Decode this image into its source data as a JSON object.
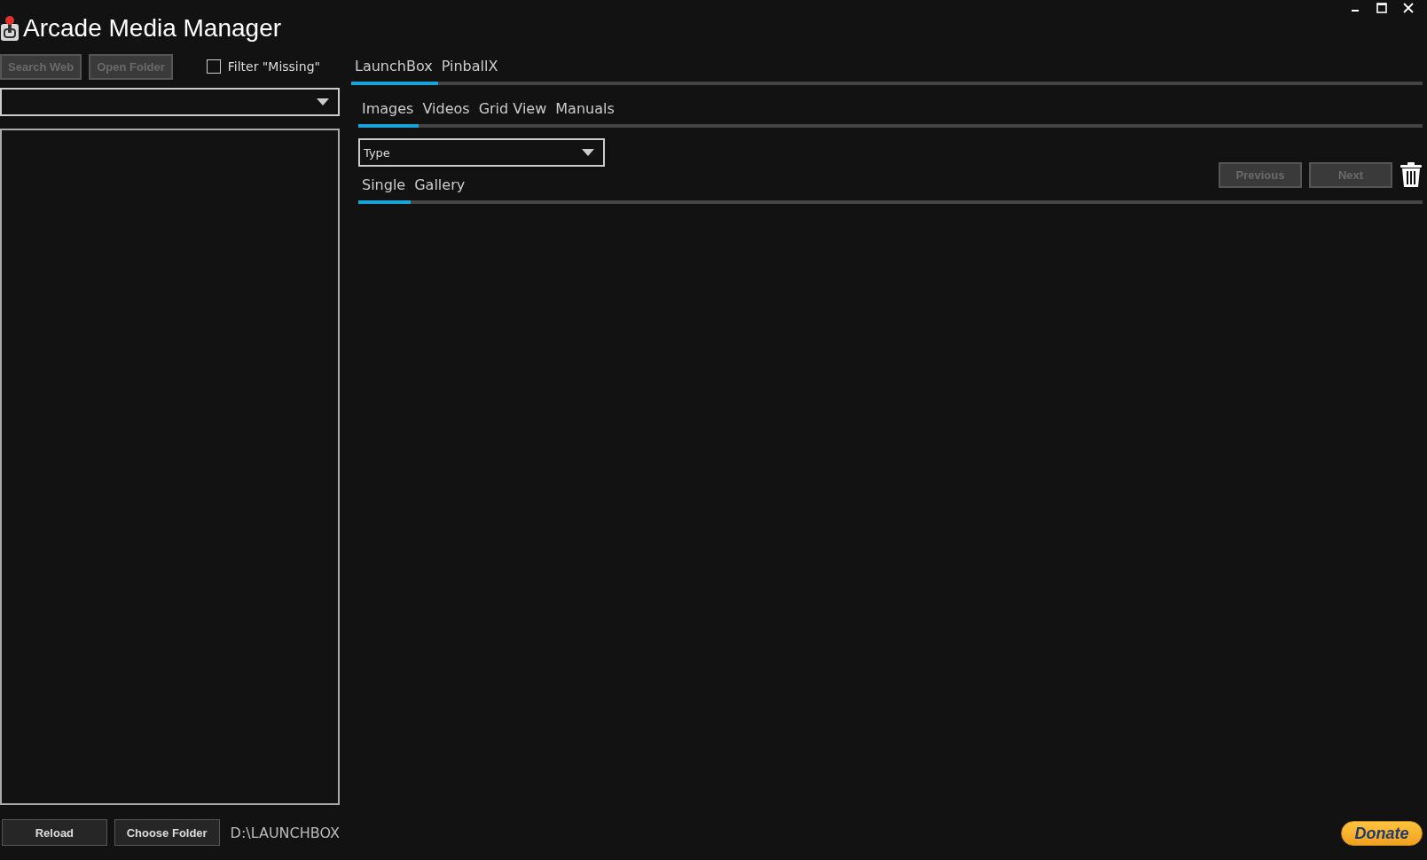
{
  "window": {
    "title": "Arcade Media Manager"
  },
  "toolbar": {
    "buttons": [
      {
        "label": "Search Web",
        "disabled": true
      },
      {
        "label": "Open Folder",
        "disabled": true
      }
    ],
    "filter": {
      "label": "Filter \"Missing\"",
      "checked": false
    }
  },
  "platform_tabs": [
    {
      "label": "LaunchBox",
      "selected": true
    },
    {
      "label": "PinballX",
      "selected": false
    }
  ],
  "media_tabs": [
    {
      "label": "Images",
      "selected": true
    },
    {
      "label": "Videos",
      "selected": false
    },
    {
      "label": "Grid View",
      "selected": false
    },
    {
      "label": "Manuals",
      "selected": false
    }
  ],
  "type_dropdown": {
    "value": "Type"
  },
  "view_tabs": [
    {
      "label": "Single",
      "selected": true
    },
    {
      "label": "Gallery",
      "selected": false
    }
  ],
  "nav_buttons": [
    {
      "label": "Previous",
      "disabled": true
    },
    {
      "label": "Next",
      "disabled": true
    }
  ],
  "footer": {
    "buttons": [
      {
        "label": "Reload",
        "disabled": false
      },
      {
        "label": "Choose Folder",
        "disabled": false
      }
    ],
    "path": "D:\\LAUNCHBOX",
    "donate": "Donate"
  }
}
